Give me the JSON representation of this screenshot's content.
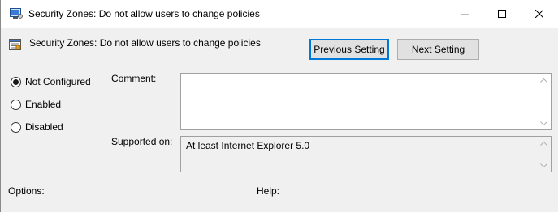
{
  "window": {
    "title": "Security Zones: Do not allow users to change policies",
    "icons": {
      "app": "policy-icon",
      "minimize": "minimize-icon",
      "maximize": "maximize-icon",
      "close": "close-icon"
    }
  },
  "header": {
    "policy_title": "Security Zones: Do not allow users to change policies",
    "icon": "policy-setting-icon"
  },
  "buttons": {
    "previous": "Previous Setting",
    "next": "Next Setting"
  },
  "options": {
    "selected": "Not Configured",
    "items": [
      "Not Configured",
      "Enabled",
      "Disabled"
    ]
  },
  "fields": {
    "comment_label": "Comment:",
    "comment_value": "",
    "supported_label": "Supported on:",
    "supported_value": "At least Internet Explorer 5.0"
  },
  "sections": {
    "options_label": "Options:",
    "help_label": "Help:"
  },
  "colors": {
    "focus_border": "#0078d7",
    "window_bg": "#f0f0f0",
    "titlebar_bg": "#ffffff"
  }
}
